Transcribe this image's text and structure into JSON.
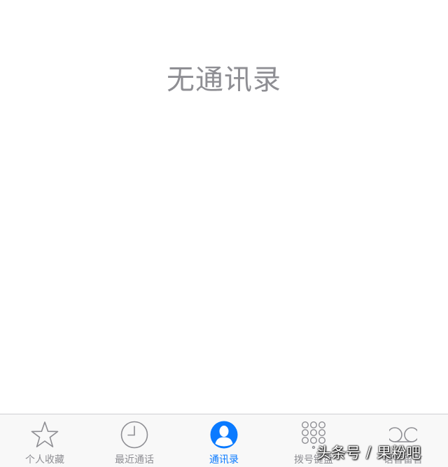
{
  "empty_state": {
    "title": "无通讯录"
  },
  "tab_bar": {
    "active_color": "#0a7aff",
    "inactive_color": "#8e8e93",
    "tabs": [
      {
        "label": "个人收藏",
        "icon": "star-icon",
        "active": false
      },
      {
        "label": "最近通话",
        "icon": "clock-icon",
        "active": false
      },
      {
        "label": "通讯录",
        "icon": "contacts-icon",
        "active": true
      },
      {
        "label": "拨号键盘",
        "icon": "keypad-icon",
        "active": false
      },
      {
        "label": "语音留言",
        "icon": "voicemail-icon",
        "active": false
      }
    ]
  },
  "watermark": {
    "source": "头条号",
    "separator": "/",
    "author": "果粉吧"
  }
}
